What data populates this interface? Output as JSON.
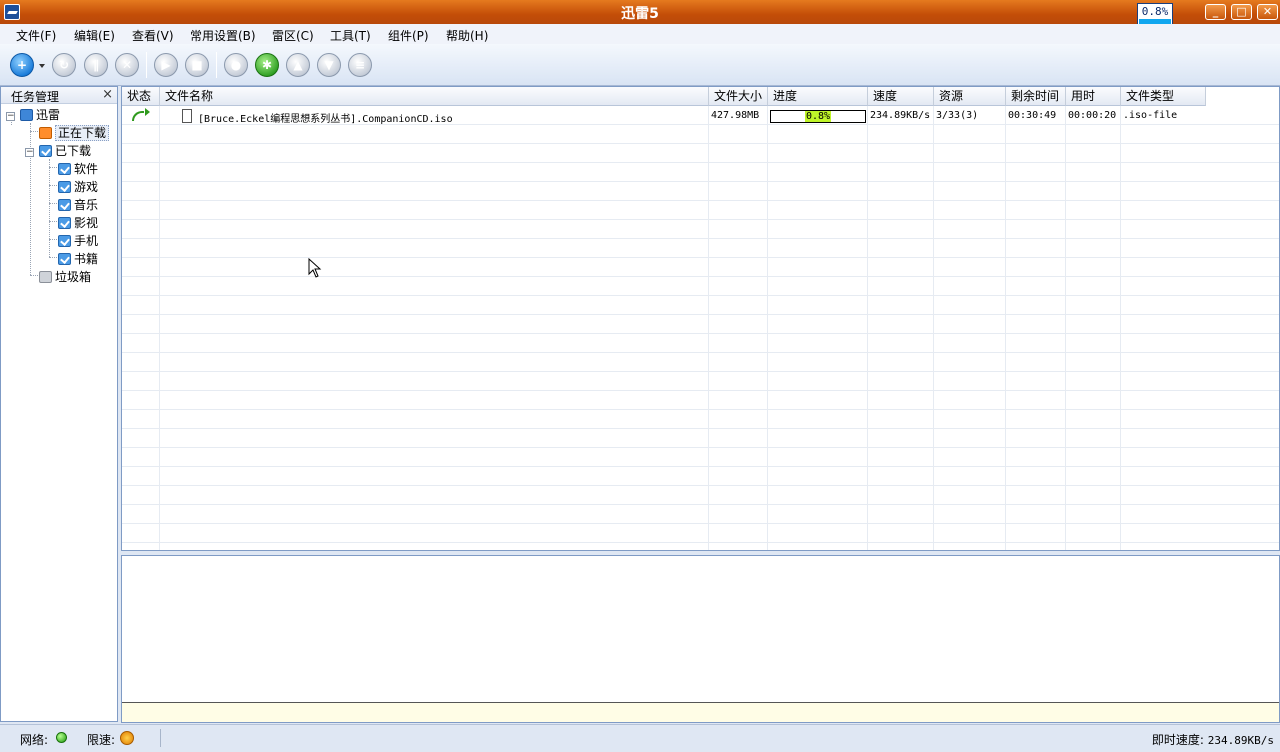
{
  "window": {
    "title": "迅雷5",
    "speed_gauge": "0.8%"
  },
  "menu": [
    {
      "label": "文件(F)"
    },
    {
      "label": "编辑(E)"
    },
    {
      "label": "查看(V)"
    },
    {
      "label": "常用设置(B)"
    },
    {
      "label": "雷区(C)"
    },
    {
      "label": "工具(T)"
    },
    {
      "label": "组件(P)"
    },
    {
      "label": "帮助(H)"
    }
  ],
  "toolbar": {
    "icons": [
      "new-task-icon",
      "restart-icon",
      "pause-icon",
      "delete-icon",
      "start-icon",
      "stop-icon",
      "camera-icon",
      "options-icon",
      "move-up-icon",
      "move-down-icon",
      "properties-icon"
    ]
  },
  "left_panel": {
    "title": "任务管理",
    "close": "×",
    "tree": [
      {
        "label": "迅雷"
      },
      {
        "label": "正在下载"
      },
      {
        "label": "已下载"
      },
      {
        "label": "软件"
      },
      {
        "label": "游戏"
      },
      {
        "label": "音乐"
      },
      {
        "label": "影视"
      },
      {
        "label": "手机"
      },
      {
        "label": "书籍"
      },
      {
        "label": "垃圾箱"
      }
    ]
  },
  "task_list": {
    "columns": [
      "状态",
      "文件名称",
      "文件大小",
      "进度",
      "速度",
      "资源",
      "剩余时间",
      "用时",
      "文件类型"
    ],
    "rows": [
      {
        "name": "[Bruce.Eckel编程思想系列丛书].CompanionCD.iso",
        "size": "427.98MB",
        "progress": "0.8%",
        "progress_value": 0.8,
        "speed": "234.89KB/s",
        "sources": "3/33(3)",
        "remaining": "00:30:49",
        "elapsed": "00:00:20",
        "type": ".iso-file"
      }
    ]
  },
  "status_bar": {
    "network_label": "网络:",
    "limit_label": "限速:",
    "instant_speed_label": "即时速度:",
    "instant_speed_value": "234.89KB/s"
  },
  "colors": {
    "title_bar": "#c44e08",
    "progress_highlight": "#bff529",
    "accent_blue": "#1679d8"
  }
}
